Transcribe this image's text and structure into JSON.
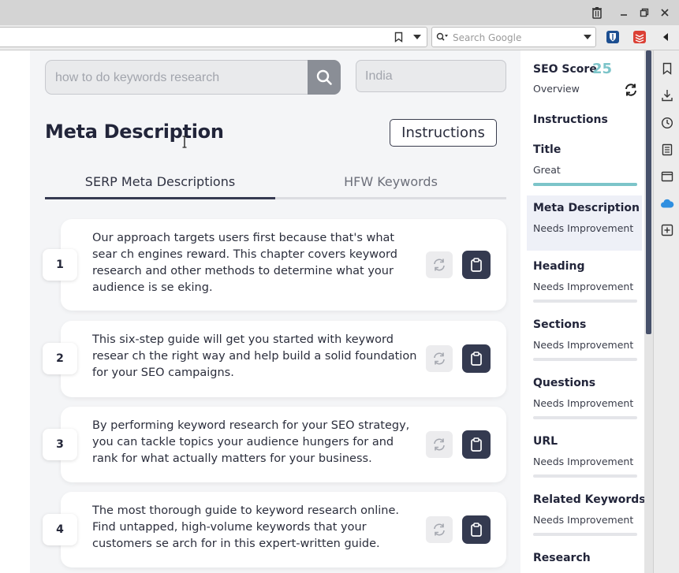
{
  "browser": {
    "search_placeholder": "Search Google"
  },
  "search": {
    "keyword_value": "how to do keywords research",
    "country_value": "India"
  },
  "main": {
    "title": "Meta Description",
    "instructions_label": "Instructions",
    "tabs": [
      {
        "label": "SERP Meta Descriptions",
        "active": true
      },
      {
        "label": "HFW Keywords",
        "active": false
      }
    ],
    "descriptions": [
      {
        "num": "1",
        "text": "Our approach targets users first because that's what sear ch engines reward. This chapter covers keyword research and other methods to determine what your audience is se eking."
      },
      {
        "num": "2",
        "text": "This six-step guide will get you started with keyword resear ch the right way and help build a solid foundation for your SEO campaigns."
      },
      {
        "num": "3",
        "text": "By performing keyword research for your SEO strategy, you can tackle topics your audience hungers for and rank for what actually matters for your business."
      },
      {
        "num": "4",
        "text": "The most thorough guide to keyword research online. Find untapped, high-volume keywords that your customers se arch for in this expert-written guide."
      }
    ]
  },
  "seo_panel": {
    "score_label": "SEO Score",
    "score_value": "25",
    "overview_label": "Overview",
    "instructions_label": "Instructions",
    "items": [
      {
        "name": "Title",
        "status": "Great",
        "progress": 1.0,
        "active": false
      },
      {
        "name": "Meta Description",
        "status": "Needs Improvement",
        "progress": 0.0,
        "active": true
      },
      {
        "name": "Heading",
        "status": "Needs Improvement",
        "progress": 0.0,
        "active": false
      },
      {
        "name": "Sections",
        "status": "Needs Improvement",
        "progress": 0.0,
        "active": false
      },
      {
        "name": "Questions",
        "status": "Needs Improvement",
        "progress": 0.0,
        "active": false
      },
      {
        "name": "URL",
        "status": "Needs Improvement",
        "progress": 0.0,
        "active": false
      },
      {
        "name": "Related Keywords",
        "status": "Needs Improvement",
        "progress": 0.0,
        "active": false
      },
      {
        "name": "Research",
        "status": "",
        "progress": 0.0,
        "active": false
      }
    ]
  },
  "colors": {
    "accent_teal": "#7cc4c9",
    "dark_button": "#343a50",
    "active_tab_bar": "#363a52"
  },
  "icons": {
    "window": [
      "trash-icon",
      "minimize-icon",
      "restore-icon",
      "close-icon"
    ],
    "navbar": [
      "bookmark-icon",
      "dropdown-icon",
      "search-engine-icon",
      "bitwarden-icon",
      "todoist-icon",
      "sidebar-toggle-icon"
    ],
    "right_strip": [
      "bookmarks-icon",
      "downloads-icon",
      "history-icon",
      "reader-icon",
      "window-icon",
      "cloud-icon",
      "add-panel-icon"
    ]
  }
}
